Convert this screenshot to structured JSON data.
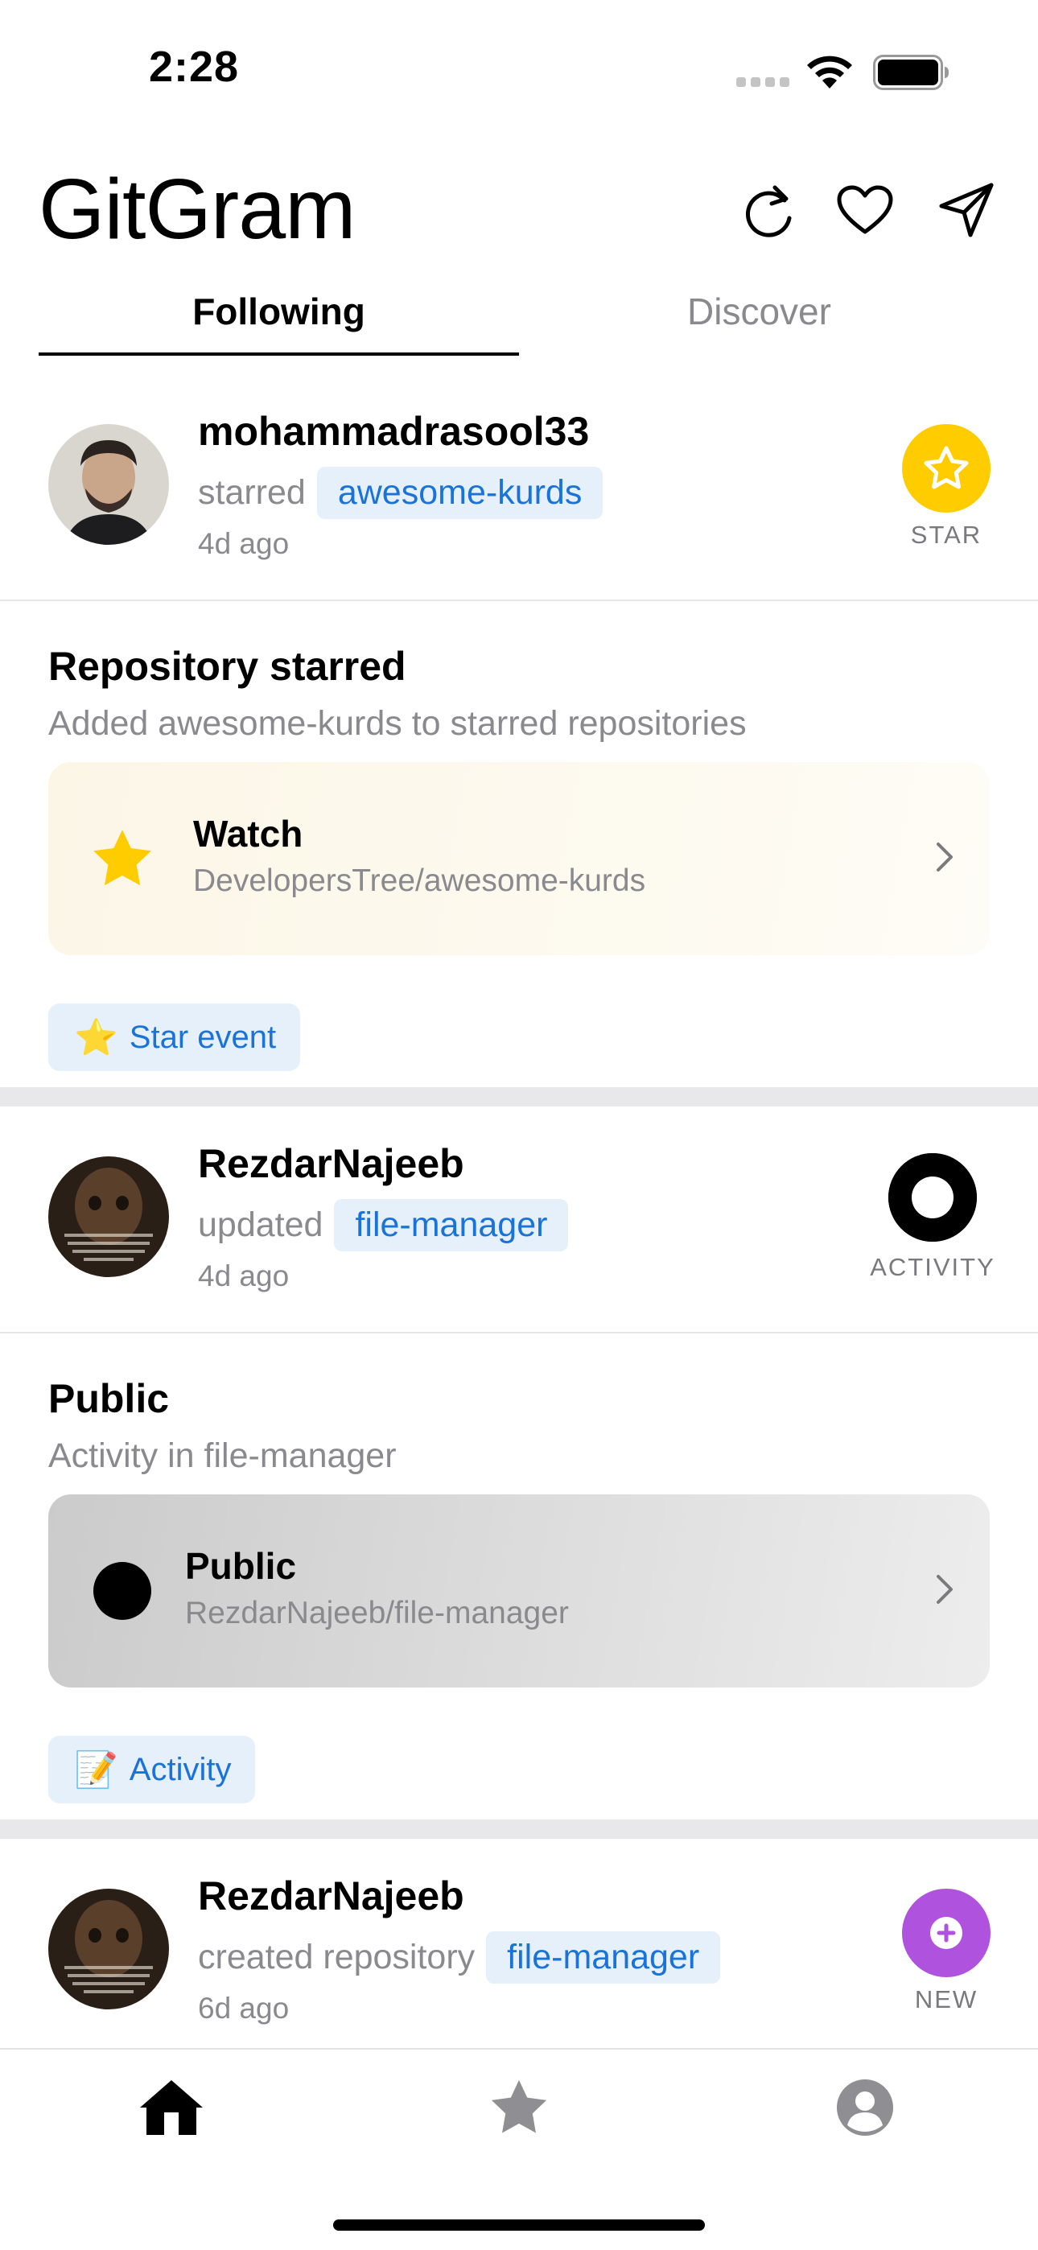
{
  "status_bar": {
    "time": "2:28",
    "icons": [
      "cellular-signal-icon",
      "wifi-icon",
      "battery-icon"
    ]
  },
  "header": {
    "title": "GitGram",
    "icons": [
      "refresh-icon",
      "heart-icon",
      "send-icon"
    ]
  },
  "tabs": [
    {
      "label": "Following",
      "active": true
    },
    {
      "label": "Discover",
      "active": false
    }
  ],
  "colors": {
    "accent": "#1a73d9",
    "star_badge": "#ffcc00",
    "new_badge": "#af52de",
    "chip_bg": "#e6f0fb"
  },
  "feed": [
    {
      "username": "mohammadrasool33",
      "verb": "starred",
      "repo": "awesome-kurds",
      "time": "4d ago",
      "badge_label": "STAR",
      "badge_icon": "star-icon",
      "title": "Repository starred",
      "subtitle": "Added awesome-kurds to starred repositories",
      "panel": {
        "icon": "star-icon",
        "title": "Watch",
        "path": "DevelopersTree/awesome-kurds"
      },
      "tag": {
        "emoji": "⭐",
        "label": "Star event"
      }
    },
    {
      "username": "RezdarNajeeb",
      "verb": "updated",
      "repo": "file-manager",
      "time": "4d ago",
      "badge_label": "ACTIVITY",
      "badge_icon": "ring-icon",
      "title": "Public",
      "subtitle": "Activity in file-manager",
      "panel": {
        "icon": "dot-icon",
        "title": "Public",
        "path": "RezdarNajeeb/file-manager"
      },
      "tag": {
        "emoji": "📝",
        "label": "Activity"
      }
    },
    {
      "username": "RezdarNajeeb",
      "verb": "created repository",
      "repo": "file-manager",
      "time": "6d ago",
      "badge_label": "NEW",
      "badge_icon": "plus-circle-icon"
    }
  ],
  "bottom_nav": [
    {
      "icon": "home-icon",
      "active": true
    },
    {
      "icon": "star-icon",
      "active": false
    },
    {
      "icon": "profile-icon",
      "active": false
    }
  ]
}
